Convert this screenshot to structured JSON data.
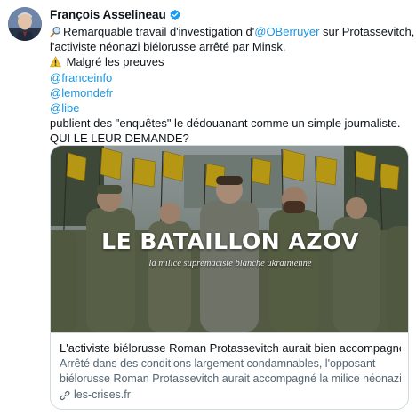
{
  "tweet": {
    "author": {
      "name": "François Asselineau",
      "verified": true
    },
    "lines": [
      {
        "emoji": "magnifier-icon",
        "text": "Remarquable travail d'investigation d'",
        "mention": "@OBerruyer",
        "after": " sur Protassevitch,"
      },
      {
        "text": "l'activiste néonazi biélorusse arrêté par Minsk."
      },
      {
        "emoji": "warning-icon",
        "text": " Malgré les preuves"
      }
    ],
    "mentions": [
      "@franceinfo",
      "@lemondefr",
      "@libe"
    ],
    "closing": [
      "publient des \"enquêtes\" le dédouanant comme un simple journaliste.",
      "QUI LE LEUR DEMANDE?"
    ]
  },
  "card": {
    "image_title": "LE BATAILLON AZOV",
    "image_subtitle": "la milice suprémaciste blanche ukrainienne",
    "title": "L'activiste biélorusse Roman Protassevitch aurait bien accompagné la ...",
    "description": [
      "Arrêté dans des conditions largement condamnables, l'opposant",
      "biélorusse Roman Protassevitch aurait accompagné la milice néonazie ..."
    ],
    "domain": "les-crises.fr"
  },
  "colors": {
    "link": "#1b95e0",
    "verified": "#1d9bf0",
    "secondary_text": "#536471",
    "border": "#cfd9de",
    "flag_yellow": "#e8c21a"
  }
}
